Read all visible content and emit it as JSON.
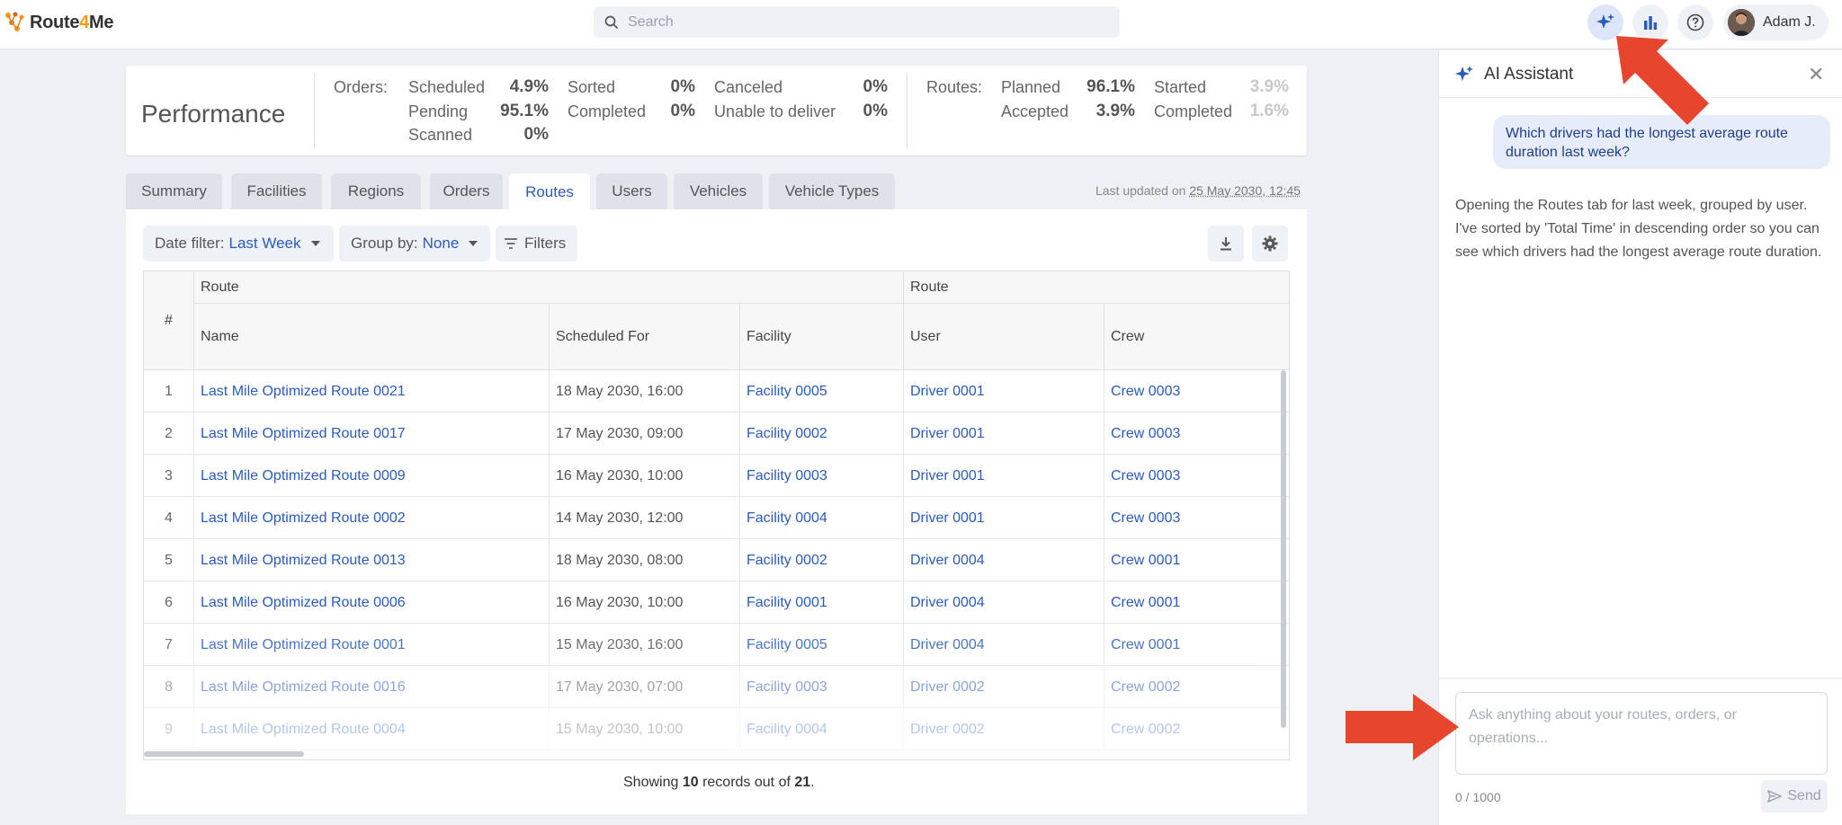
{
  "app": {
    "logo_prefix": "Route",
    "logo_four": "4",
    "logo_suffix": "Me"
  },
  "search": {
    "placeholder": "Search"
  },
  "user": {
    "name": "Adam J."
  },
  "performance": {
    "title": "Performance",
    "orders_label": "Orders:",
    "routes_label": "Routes:",
    "orders": [
      {
        "label": "Scheduled",
        "value": "4.9%"
      },
      {
        "label": "Pending",
        "value": "95.1%"
      },
      {
        "label": "Scanned",
        "value": "0%"
      },
      {
        "label": "Sorted",
        "value": "0%"
      },
      {
        "label": "Completed",
        "value": "0%"
      },
      {
        "label": "Canceled",
        "value": "0%"
      },
      {
        "label": "Unable to deliver",
        "value": "0%"
      }
    ],
    "routes": [
      {
        "label": "Planned",
        "value": "96.1%"
      },
      {
        "label": "Accepted",
        "value": "3.9%"
      },
      {
        "label": "Started",
        "value": "3.9%"
      },
      {
        "label": "Completed",
        "value": "1.6%"
      }
    ]
  },
  "tabs": [
    "Summary",
    "Facilities",
    "Regions",
    "Orders",
    "Routes",
    "Users",
    "Vehicles",
    "Vehicle Types"
  ],
  "active_tab": "Routes",
  "last_updated": {
    "label": "Last updated on",
    "date": "25 May 2030, 12:45"
  },
  "filters": {
    "date_label": "Date filter:",
    "date_value": "Last Week",
    "group_label": "Group by:",
    "group_value": "None",
    "filters_label": "Filters"
  },
  "table": {
    "group_headers": [
      "Route",
      "Route"
    ],
    "columns": [
      "#",
      "Name",
      "Scheduled For",
      "Facility",
      "User",
      "Crew"
    ],
    "rows": [
      {
        "n": "1",
        "name": "Last Mile Optimized Route 0021",
        "date": "18 May 2030, 16:00",
        "facility": "Facility 0005",
        "user": "Driver 0001",
        "crew": "Crew 0003"
      },
      {
        "n": "2",
        "name": "Last Mile Optimized Route 0017",
        "date": "17 May 2030, 09:00",
        "facility": "Facility 0002",
        "user": "Driver 0001",
        "crew": "Crew 0003"
      },
      {
        "n": "3",
        "name": "Last Mile Optimized Route 0009",
        "date": "16 May 2030, 10:00",
        "facility": "Facility 0003",
        "user": "Driver 0001",
        "crew": "Crew 0003"
      },
      {
        "n": "4",
        "name": "Last Mile Optimized Route 0002",
        "date": "14 May 2030, 12:00",
        "facility": "Facility 0004",
        "user": "Driver 0001",
        "crew": "Crew 0003"
      },
      {
        "n": "5",
        "name": "Last Mile Optimized Route 0013",
        "date": "18 May 2030, 08:00",
        "facility": "Facility 0002",
        "user": "Driver 0004",
        "crew": "Crew 0001"
      },
      {
        "n": "6",
        "name": "Last Mile Optimized Route 0006",
        "date": "16 May 2030, 10:00",
        "facility": "Facility 0001",
        "user": "Driver 0004",
        "crew": "Crew 0001"
      },
      {
        "n": "7",
        "name": "Last Mile Optimized Route 0001",
        "date": "15 May 2030, 16:00",
        "facility": "Facility 0005",
        "user": "Driver 0004",
        "crew": "Crew 0001"
      },
      {
        "n": "8",
        "name": "Last Mile Optimized Route 0016",
        "date": "17 May 2030, 07:00",
        "facility": "Facility 0003",
        "user": "Driver 0002",
        "crew": "Crew 0002"
      },
      {
        "n": "9",
        "name": "Last Mile Optimized Route 0004",
        "date": "15 May 2030, 10:00",
        "facility": "Facility 0004",
        "user": "Driver 0002",
        "crew": "Crew 0002"
      }
    ]
  },
  "showing": {
    "prefix": "Showing",
    "count": "10",
    "middle": "records out of",
    "total": "21",
    "suffix": "."
  },
  "ai": {
    "title": "AI Assistant",
    "user_message": "Which drivers had the longest average route duration last week?",
    "assistant_message": "Opening the Routes tab for last week, grouped by user. I've sorted by 'Total Time' in descending order so you can see which drivers had the longest average route duration.",
    "input_placeholder": "Ask anything about your routes, orders, or operations...",
    "counter": "0 / 1000",
    "send_label": "Send"
  },
  "colors": {
    "accent": "#2a5bbd",
    "arrow": "#e8452e",
    "brand_orange": "#f39c12"
  }
}
